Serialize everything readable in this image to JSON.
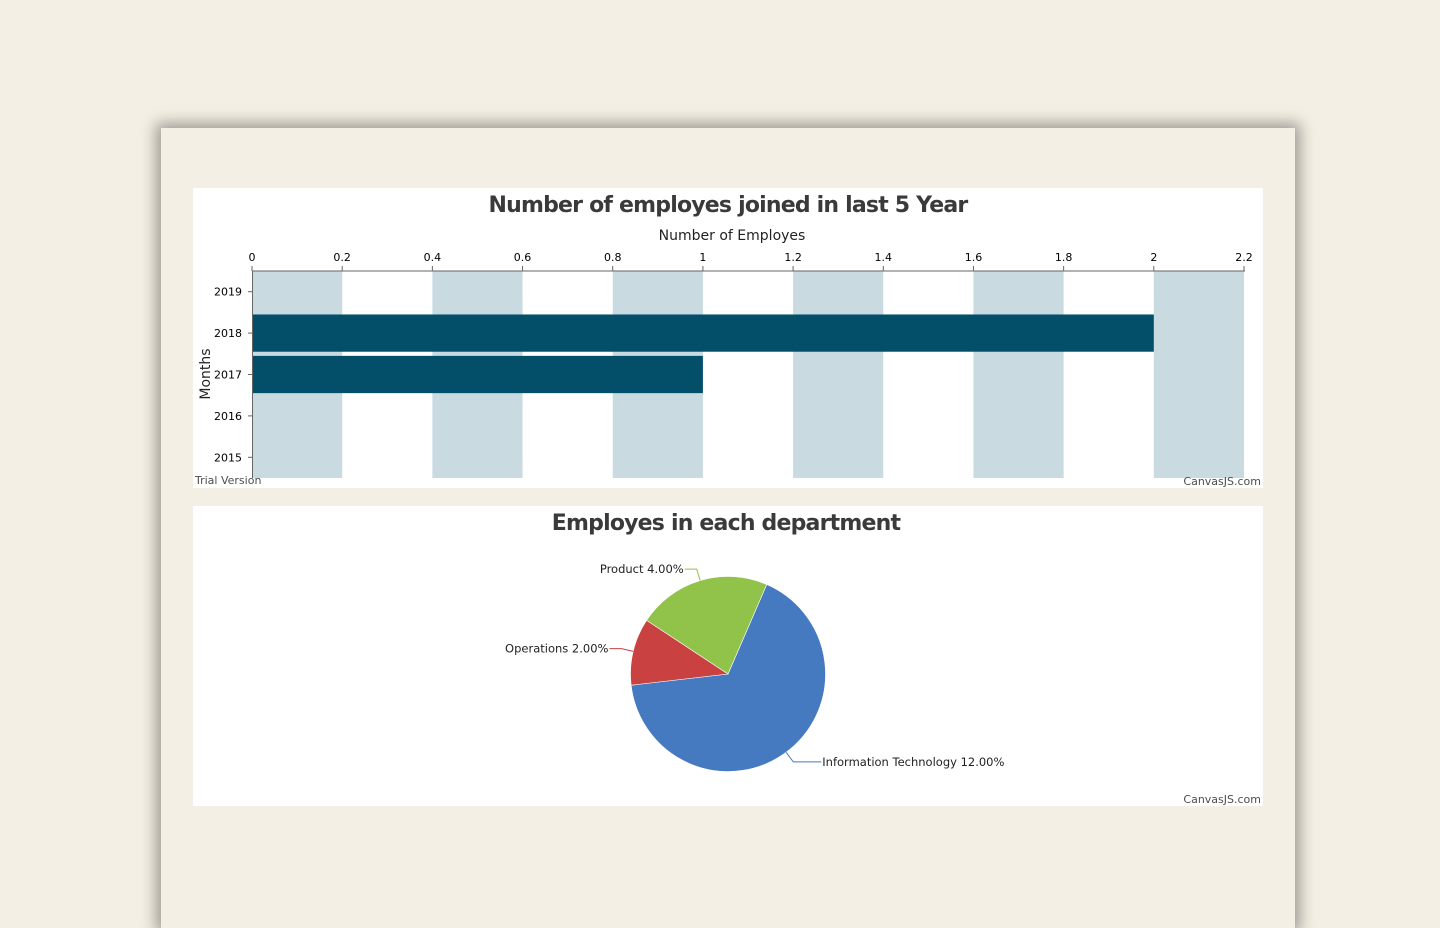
{
  "charts": {
    "bar": {
      "credit_left": "Trial Version",
      "credit_right": "CanvasJS.com"
    },
    "pie": {
      "credit_right": "CanvasJS.com"
    }
  },
  "colors": {
    "bar": "#034f6a",
    "stripe": "#c9dae1",
    "it": "#4579c0",
    "ops": "#c94141",
    "product": "#91c24a"
  },
  "chart_data": [
    {
      "type": "bar",
      "orientation": "horizontal",
      "title": "Number of employes joined in last 5 Year",
      "xlabel": "Number of Employes",
      "ylabel": "Months",
      "categories": [
        "2015",
        "2016",
        "2017",
        "2018",
        "2019"
      ],
      "values": [
        0,
        0,
        1,
        2,
        0
      ],
      "xlim": [
        0,
        2.2
      ],
      "xticks": [
        "0",
        "0.2",
        "0.4",
        "0.6",
        "0.8",
        "1",
        "1.2",
        "1.4",
        "1.6",
        "1.8",
        "2",
        "2.2"
      ],
      "grid": "alternating interlaced bands"
    },
    {
      "type": "pie",
      "title": "Employes in each department",
      "slices": [
        {
          "label": "Information Technology",
          "value": 12,
          "display": "12.00%"
        },
        {
          "label": "Operations",
          "value": 2,
          "display": "2.00%"
        },
        {
          "label": "Product",
          "value": 4,
          "display": "4.00%"
        }
      ]
    }
  ]
}
